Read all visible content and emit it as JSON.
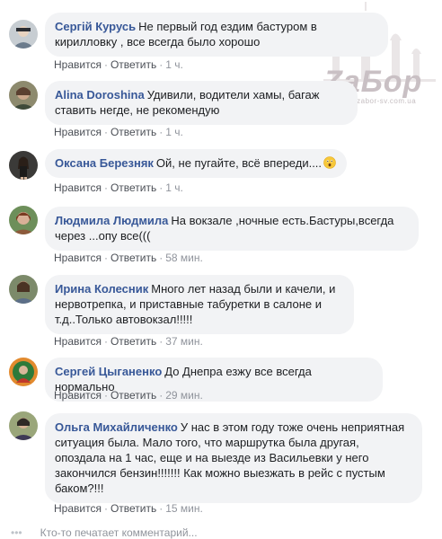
{
  "watermark": {
    "text": "ZaБор",
    "url": "www.zabor-sv.com.ua"
  },
  "action_labels": {
    "like": "Нравится",
    "reply": "Ответить",
    "separator": "·"
  },
  "comments": [
    {
      "author": "Сергій Курусь",
      "text": "Не первый год ездим бастуром в кирилловку , все всегда было хорошо",
      "time": "1 ч."
    },
    {
      "author": "Alina Doroshina",
      "text": "Удивили, водители хамы, багаж ставить негде, не рекомендую",
      "time": "1 ч."
    },
    {
      "author": "Оксана Березняк",
      "text": "Ой, не пугайте, всё впереди....",
      "time": "1 ч.",
      "emoji": "astonished-face"
    },
    {
      "author": "Людмила Людмила",
      "text": "На вокзале ,ночные есть.Бастуры,всегда через ...опу все(((",
      "time": "58 мин."
    },
    {
      "author": "Ирина Колесник",
      "text": "Много лет назад были и качели, и нервотрепка, и приставные табуретки в салоне и т.д..Только автовокзал!!!!!",
      "time": "37 мин."
    },
    {
      "author": "Сергей Цыганенко",
      "text": "До Днепра езжу все всегда нормально",
      "time": "29 мин."
    },
    {
      "author": "Ольга Михайличенко",
      "text": "У нас в этом году тоже очень неприятная ситуация была. Мало того, что маршрутка была другая, опоздала на 1 час, еще и на выезде из Васильевки у него закончился бензин!!!!!!! Как можно выезжать в рейс с пустым баком?!!!",
      "time": "15 мин."
    }
  ],
  "typing_indicator": "Кто-то печатает комментарий...",
  "colors": {
    "author": "#385898",
    "bubble": "#f2f3f5",
    "meta": "#90949c"
  }
}
